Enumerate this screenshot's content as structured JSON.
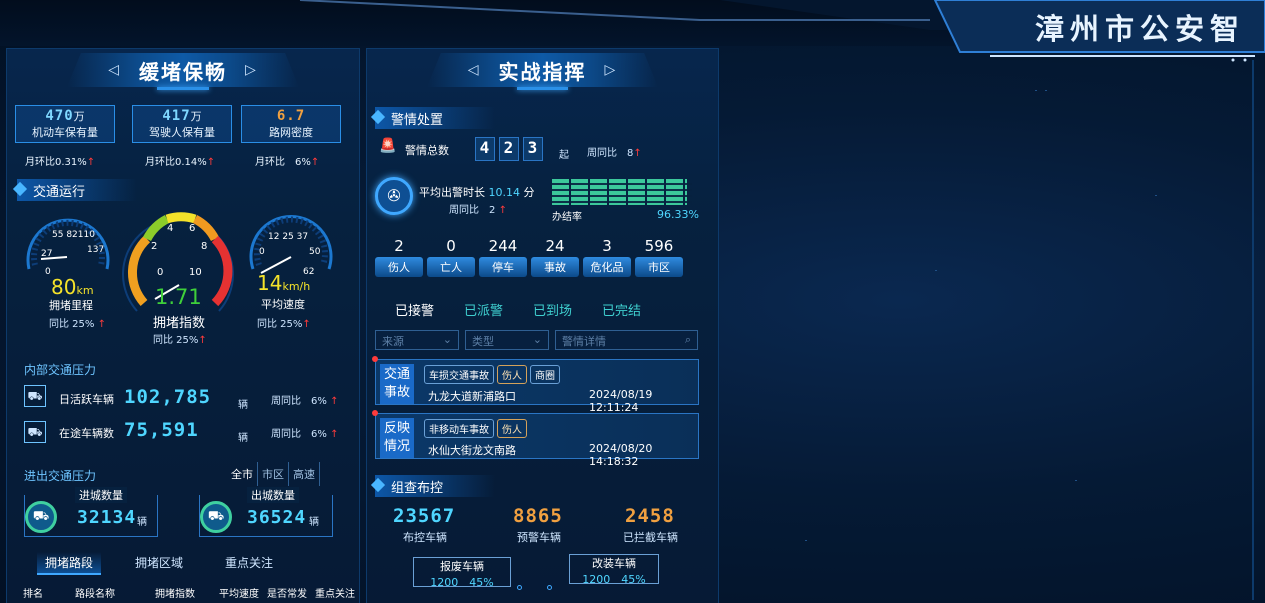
{
  "header": {
    "title": "漳州市公安智"
  },
  "left": {
    "title": "缓堵保畅",
    "stats": [
      {
        "value": "470",
        "unit": "万",
        "label": "机动车保有量",
        "cmp": "月环比0.31%"
      },
      {
        "value": "417",
        "unit": "万",
        "label": "驾驶人保有量",
        "cmp": "月环比0.14%"
      },
      {
        "value": "6.7",
        "unit": "",
        "label": "路网密度",
        "cmp": "月环比　6%"
      }
    ],
    "traffic_title": "交通运行",
    "gauge_left": {
      "ticks": [
        "55",
        "82",
        "110",
        "27",
        "137",
        "0"
      ],
      "value": "80",
      "unit": "km",
      "label": "拥堵里程",
      "cmp": "同比 25%"
    },
    "gauge_mid": {
      "ticks": [
        "4",
        "6",
        "2",
        "8",
        "0",
        "10"
      ],
      "value": "1.71",
      "label": "拥堵指数",
      "cmp": "同比 25%"
    },
    "gauge_right": {
      "ticks": [
        "12",
        "25",
        "37",
        "0",
        "50",
        "62"
      ],
      "value": "14",
      "unit": "km/h",
      "label": "平均速度",
      "cmp": "同比 25%"
    },
    "internal_title": "内部交通压力",
    "internal": [
      {
        "label": "日活跃车辆",
        "value": "102,785",
        "unit": "辆",
        "cmp": "周同比　6%"
      },
      {
        "label": "在途车辆数",
        "value": "75,591",
        "unit": "辆",
        "cmp": "周同比　6%"
      }
    ],
    "inout_title": "进出交通压力",
    "inout_tabs": [
      "全市",
      "市区",
      "高速"
    ],
    "in": {
      "label": "进城数量",
      "value": "32134",
      "unit": "辆"
    },
    "out": {
      "label": "出城数量",
      "value": "36524",
      "unit": "辆"
    },
    "bottom_tabs": [
      "拥堵路段",
      "拥堵区域",
      "重点关注"
    ],
    "table_headers": [
      "排名",
      "路段名称",
      "拥堵指数",
      "平均速度",
      "是否常发",
      "重点关注"
    ]
  },
  "right": {
    "title": "实战指挥",
    "alarm_title": "警情处置",
    "alarm_total_label": "警情总数",
    "alarm_digits": [
      "4",
      "2",
      "3"
    ],
    "alarm_unit": "起",
    "alarm_cmp": "周同比　8",
    "avg_label": "平均出警时长",
    "avg_value": "10.14",
    "avg_unit": "分",
    "avg_cmp": "周同比　2",
    "close_label": "办结率",
    "close_rate": "96.33%",
    "close_fraction": 0.9633,
    "counters": [
      {
        "n": "2",
        "l": "伤人"
      },
      {
        "n": "0",
        "l": "亡人"
      },
      {
        "n": "244",
        "l": "停车"
      },
      {
        "n": "24",
        "l": "事故"
      },
      {
        "n": "3",
        "l": "危化品"
      },
      {
        "n": "596",
        "l": "市区"
      }
    ],
    "status_tabs": [
      "已接警",
      "已派警",
      "已到场",
      "已完结"
    ],
    "filters": {
      "source": "来源",
      "type": "类型",
      "detail": "警情详情"
    },
    "incidents": [
      {
        "tag1": "交通",
        "tag2": "事故",
        "chips": [
          "车损交通事故",
          "伤人",
          "商圈"
        ],
        "place": "九龙大道新浦路口",
        "time": "2024/08/19 12:11:24"
      },
      {
        "tag1": "反映",
        "tag2": "情况",
        "chips": [
          "非移动车事故",
          "伤人"
        ],
        "place": "水仙大街龙文南路",
        "time": "2024/08/20 14:18:32"
      }
    ],
    "control_title": "组查布控",
    "control_stats": [
      {
        "value": "23567",
        "label": "布控车辆"
      },
      {
        "value": "8865",
        "label": "预警车辆"
      },
      {
        "value": "2458",
        "label": "已拦截车辆"
      }
    ],
    "scrap": {
      "label": "报废车辆",
      "value": "1200",
      "pct": "45%"
    },
    "modify": {
      "label": "改装车辆",
      "value": "1200",
      "pct": "45%"
    }
  }
}
